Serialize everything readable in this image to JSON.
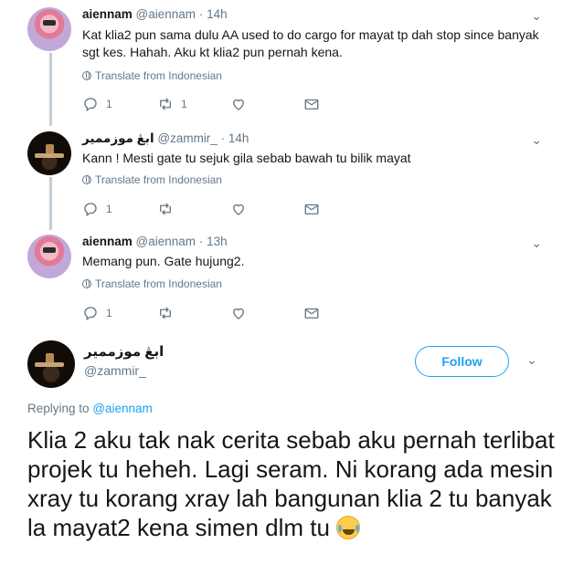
{
  "replies": [
    {
      "display_name": "aiennam",
      "handle": "@aiennam",
      "separator": "·",
      "time": "14h",
      "text": "Kat klia2 pun sama dulu AA used to do cargo for mayat tp dah stop since banyak sgt kes. Hahah. Aku kt klia2 pun pernah kena.",
      "translate_label": "Translate from Indonesian",
      "reply_count": "1",
      "retweet_count": "1",
      "like_count": ""
    },
    {
      "display_name": "ابڠ موزممير",
      "handle": "@zammir_",
      "separator": "·",
      "time": "14h",
      "text": "Kann ! Mesti gate tu sejuk gila sebab bawah tu bilik mayat",
      "translate_label": "Translate from Indonesian",
      "reply_count": "1",
      "retweet_count": "",
      "like_count": ""
    },
    {
      "display_name": "aiennam",
      "handle": "@aiennam",
      "separator": "·",
      "time": "13h",
      "text": "Memang pun. Gate hujung2.",
      "translate_label": "Translate from Indonesian",
      "reply_count": "1",
      "retweet_count": "",
      "like_count": ""
    }
  ],
  "focal": {
    "display_name": "ابڠ موزممير",
    "handle": "@zammir_",
    "follow_label": "Follow",
    "replying_prefix": "Replying to",
    "replying_to": "@aiennam",
    "text": "Klia 2 aku tak nak cerita sebab aku pernah terlibat projek tu heheh. Lagi seram. Ni korang ada mesin xray tu korang xray lah bangunan klia 2 tu banyak la mayat2 kena simen dlm tu"
  },
  "icons": {
    "chevron": "chevron-down-icon",
    "reply": "reply-icon",
    "retweet": "retweet-icon",
    "like": "heart-icon",
    "message": "envelope-icon",
    "translate": "globe-icon",
    "emoji": "tears-of-joy-emoji"
  },
  "colors": {
    "accent": "#1da1f2",
    "secondary_text": "#657786",
    "thread_line": "#c4cfd6"
  }
}
